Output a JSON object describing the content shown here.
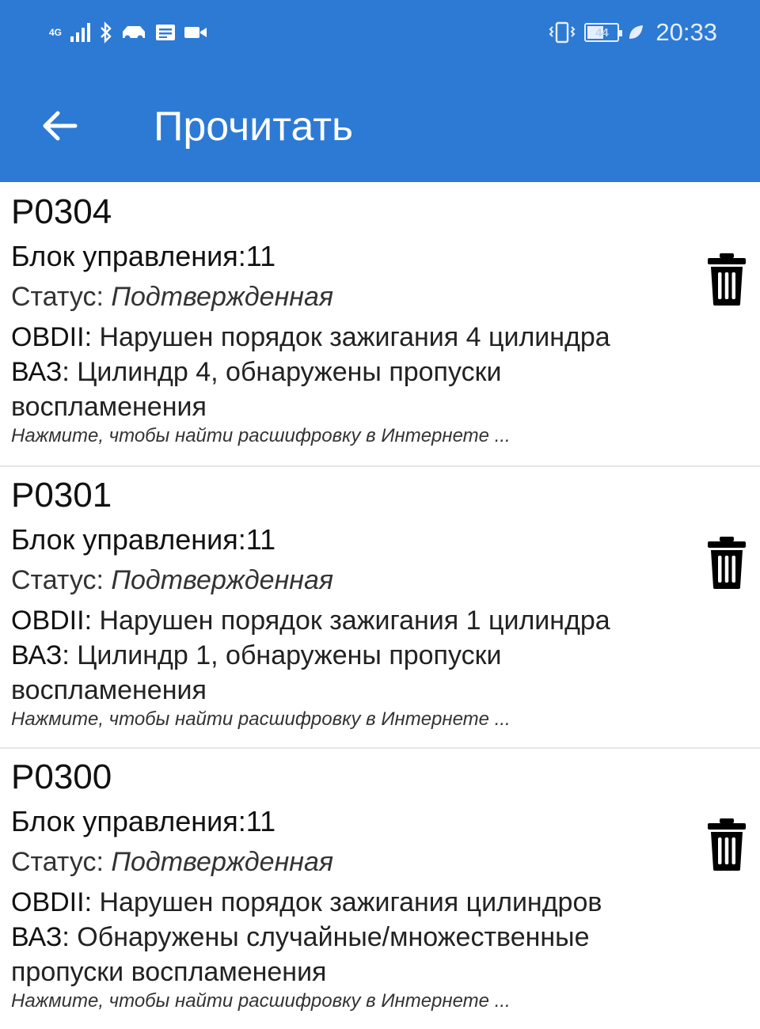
{
  "status_bar": {
    "network_label": "4G",
    "time": "20:33",
    "battery_level": "44",
    "left_icons": [
      "signal-icon",
      "bluetooth-icon",
      "car-icon",
      "message-icon",
      "video-icon"
    ],
    "right_icons": [
      "vibrate-icon",
      "battery-icon",
      "leaf-icon"
    ]
  },
  "appbar": {
    "title": "Прочитать",
    "back_icon": "arrow-left-icon",
    "color": "#2d7ad4"
  },
  "errors": [
    {
      "code": "P0304",
      "unit": "Блок управления:11",
      "status_label": "Статус:",
      "status_value": "Подтвержденная",
      "obd_label": "OBDII:",
      "obd_text": "Нарушен порядок зажигания 4 цилиндра",
      "vaz_label": "ВАЗ:",
      "vaz_text": "Цилиндр 4, обнаружены пропуски воспламенения",
      "hint": "Нажмите, чтобы найти расшифровку в Интернете ...",
      "delete_icon": "trash-icon"
    },
    {
      "code": "P0301",
      "unit": "Блок управления:11",
      "status_label": "Статус:",
      "status_value": "Подтвержденная",
      "obd_label": "OBDII:",
      "obd_text": "Нарушен порядок зажигания 1 цилиндра",
      "vaz_label": "ВАЗ:",
      "vaz_text": "Цилиндр 1, обнаружены пропуски воспламенения",
      "hint": "Нажмите, чтобы найти расшифровку в Интернете ...",
      "delete_icon": "trash-icon"
    },
    {
      "code": "P0300",
      "unit": "Блок управления:11",
      "status_label": "Статус:",
      "status_value": "Подтвержденная",
      "obd_label": "OBDII:",
      "obd_text": "Нарушен порядок зажигания цилиндров",
      "vaz_label": "ВАЗ:",
      "vaz_text": "Обнаружены случайные/множественные пропуски воспламенения",
      "hint": "Нажмите, чтобы найти расшифровку в Интернете ...",
      "delete_icon": "trash-icon"
    }
  ]
}
